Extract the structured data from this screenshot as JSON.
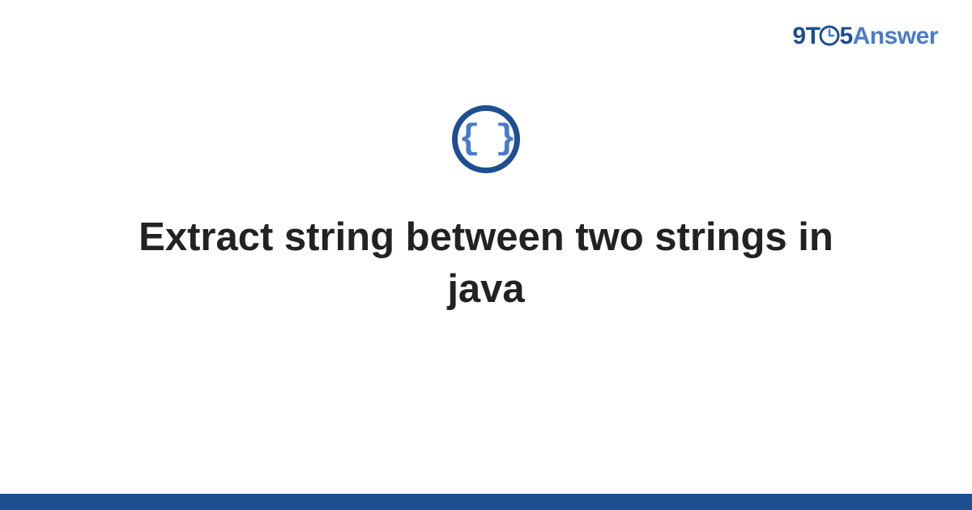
{
  "logo": {
    "part1": "9T",
    "part2": "5",
    "part3": "Answer"
  },
  "icon": {
    "braces": "{ }"
  },
  "title": "Extract string between two strings in java",
  "colors": {
    "primary": "#1d4f91",
    "secondary": "#4a7bc8",
    "text": "#222222"
  }
}
